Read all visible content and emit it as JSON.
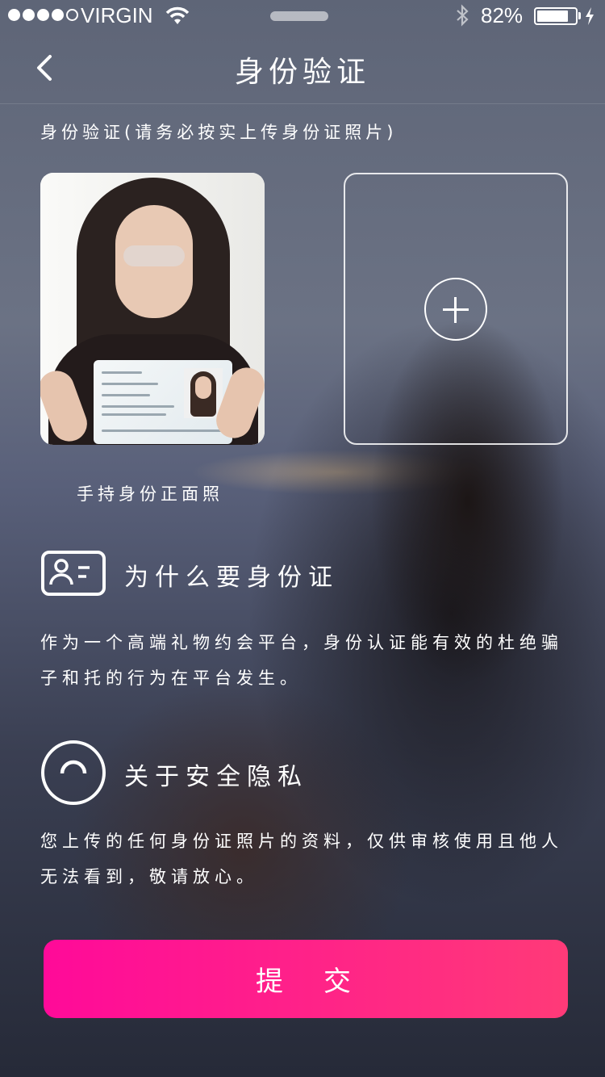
{
  "status_bar": {
    "carrier": "VIRGIN",
    "signal_filled": 4,
    "signal_total": 5,
    "battery_percent": "82%",
    "battery_level": 0.82
  },
  "nav": {
    "title": "身份验证",
    "back_icon": "chevron-left-icon"
  },
  "upload": {
    "instruction": "身份验证(请务必按实上传身份证照片)",
    "example_caption": "手持身份正面照",
    "add_icon": "plus-circle-icon"
  },
  "sections": [
    {
      "icon": "id-card-icon",
      "title": "为什么要身份证",
      "text": "作为一个高端礼物约会平台，身份认证能有效的杜绝骗子和托的行为在平台发生。"
    },
    {
      "icon": "privacy-icon",
      "title": "关于安全隐私",
      "text": "您上传的任何身份证照片的资料，仅供审核使用且他人无法看到，敬请放心。"
    }
  ],
  "submit_label": "提交",
  "colors": {
    "button_start": "#ff0a99",
    "button_end": "#ff3a78",
    "text": "#ffffff"
  }
}
